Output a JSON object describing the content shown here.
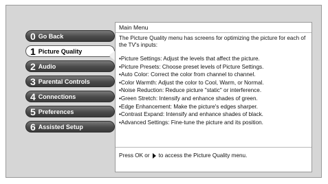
{
  "menu": {
    "items": [
      {
        "num": "0",
        "label": "Go Back",
        "selected": false
      },
      {
        "num": "1",
        "label": "Picture Quality",
        "selected": true
      },
      {
        "num": "2",
        "label": "Audio",
        "selected": false
      },
      {
        "num": "3",
        "label": "Parental Controls",
        "selected": false
      },
      {
        "num": "4",
        "label": "Connections",
        "selected": false
      },
      {
        "num": "5",
        "label": "Preferences",
        "selected": false
      },
      {
        "num": "6",
        "label": "Assisted Setup",
        "selected": false
      }
    ]
  },
  "panel": {
    "title": "Main Menu",
    "intro": "The Picture Quality menu has screens for optimizing the picture for each of the TV's inputs:",
    "bullets": [
      "•Picture Settings: Adjust the levels that affect the picture.",
      "•Picture Presets: Choose preset levels of Picture Settings.",
      "•Auto Color: Correct the color from channel to channel.",
      "•Color Warmth: Adjust the color to Cool, Warm, or Normal.",
      "•Noise Reduction: Reduce picture \"static\" or interference.",
      "•Green Stretch: Intensify and enhance shades of green.",
      "•Edge Enhancement: Make the picture's edges sharper.",
      "•Contrast Expand: Intensify and enhance shades of black.",
      "•Advanced Settings: Fine-tune the picture and its position."
    ],
    "footer_before": "Press OK or",
    "footer_icon": "right-arrow-icon",
    "footer_after": "to access the Picture Quality menu."
  }
}
